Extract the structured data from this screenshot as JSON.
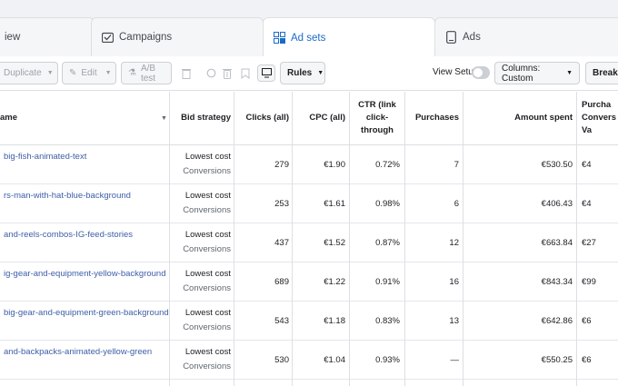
{
  "tabs": [
    {
      "label": "iew",
      "icon": "none"
    },
    {
      "label": "Campaigns",
      "icon": "campaign-folder-icon"
    },
    {
      "label": "Ad sets",
      "icon": "ad-sets-grid-icon"
    },
    {
      "label": "Ads",
      "icon": "ad-device-icon"
    }
  ],
  "toolbar": {
    "duplicate": "Duplicate",
    "edit": "Edit",
    "ab_test": "A/B test",
    "rules": "Rules",
    "view_setup": "View Setup",
    "columns": "Columns: Custom",
    "breakdown": "Breakdo"
  },
  "table": {
    "headers": {
      "name": "ame",
      "bid_strategy": "Bid strategy",
      "clicks": "Clicks (all)",
      "cpc": "CPC (all)",
      "ctr": "CTR (link click-through",
      "purchases": "Purchases",
      "amount_spent": "Amount spent",
      "conv": "Purcha Convers Va"
    },
    "rows": [
      {
        "name": "big-fish-animated-text",
        "bid1": "Lowest cost",
        "bid2": "Conversions",
        "clicks": "279",
        "cpc": "€1.90",
        "ctr": "0.72%",
        "purchases": "7",
        "spent": "€530.50",
        "conv": "€4"
      },
      {
        "name": "rs-man-with-hat-blue-background",
        "bid1": "Lowest cost",
        "bid2": "Conversions",
        "clicks": "253",
        "cpc": "€1.61",
        "ctr": "0.98%",
        "purchases": "6",
        "spent": "€406.43",
        "conv": "€4"
      },
      {
        "name": "and-reels-combos-IG-feed-stories",
        "bid1": "Lowest cost",
        "bid2": "Conversions",
        "clicks": "437",
        "cpc": "€1.52",
        "ctr": "0.87%",
        "purchases": "12",
        "spent": "€663.84",
        "conv": "€27"
      },
      {
        "name": "ig-gear-and-equipment-yellow-background",
        "bid1": "Lowest cost",
        "bid2": "Conversions",
        "clicks": "689",
        "cpc": "€1.22",
        "ctr": "0.91%",
        "purchases": "16",
        "spent": "€843.34",
        "conv": "€99"
      },
      {
        "name": "big-gear-and-equipment-green-background",
        "bid1": "Lowest cost",
        "bid2": "Conversions",
        "clicks": "543",
        "cpc": "€1.18",
        "ctr": "0.83%",
        "purchases": "13",
        "spent": "€642.86",
        "conv": "€6"
      },
      {
        "name": "and-backpacks-animated-yellow-green",
        "bid1": "Lowest cost",
        "bid2": "Conversions",
        "clicks": "530",
        "cpc": "€1.04",
        "ctr": "0.93%",
        "purchases": "—",
        "spent": "€550.25",
        "conv": "€6"
      }
    ]
  },
  "colors": {
    "link": "#3e5ea7",
    "active_tab": "#1b6ac9",
    "border": "#dddfe2"
  }
}
